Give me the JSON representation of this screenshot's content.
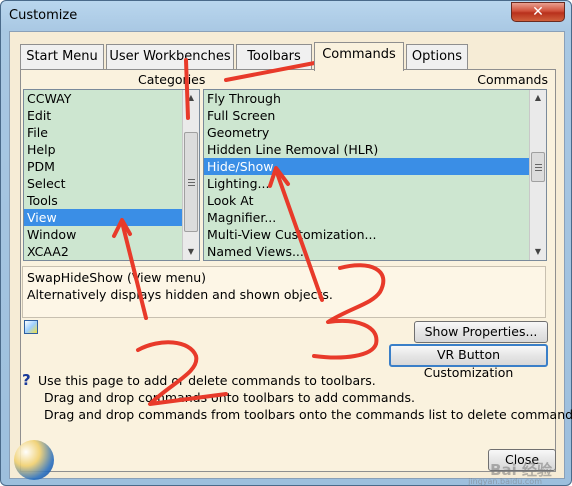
{
  "window": {
    "title": "Customize",
    "close_label": "✕"
  },
  "tabs": [
    {
      "label": "Start Menu"
    },
    {
      "label": "User Workbenches"
    },
    {
      "label": "Toolbars"
    },
    {
      "label": "Commands",
      "active": true
    },
    {
      "label": "Options"
    }
  ],
  "categories": {
    "label": "Categories",
    "items": [
      "CCWAY",
      "Edit",
      "File",
      "Help",
      "PDM",
      "Select",
      "Tools",
      "View",
      "Window",
      "XCAA2"
    ],
    "selected": "View"
  },
  "commands": {
    "label": "Commands",
    "items": [
      "Fly Through",
      "Full Screen",
      "Geometry",
      "Hidden Line Removal (HLR)",
      "Hide/Show",
      "Lighting...",
      "Look At",
      "Magnifier...",
      "Multi-View Customization...",
      "Named Views..."
    ],
    "selected": "Hide/Show"
  },
  "description": {
    "line1": "SwapHideShow (View menu)",
    "line2": "Alternatively displays hidden and shown objects."
  },
  "buttons": {
    "show_properties": "Show Properties...",
    "vr_button": "VR Button Customization",
    "close": "Close"
  },
  "help": {
    "line1": "Use this page to add or delete commands to toolbars.",
    "line2": "Drag and drop commands onto toolbars to add commands.",
    "line3": "Drag and drop commands from toolbars onto the commands list to delete command."
  },
  "watermark": {
    "text": "Bai 经验",
    "sub": "jingyan.baidu.com"
  },
  "colors": {
    "list_bg": "#cde6d0",
    "selection": "#3a8ee6",
    "annotation": "#e83a2a"
  }
}
